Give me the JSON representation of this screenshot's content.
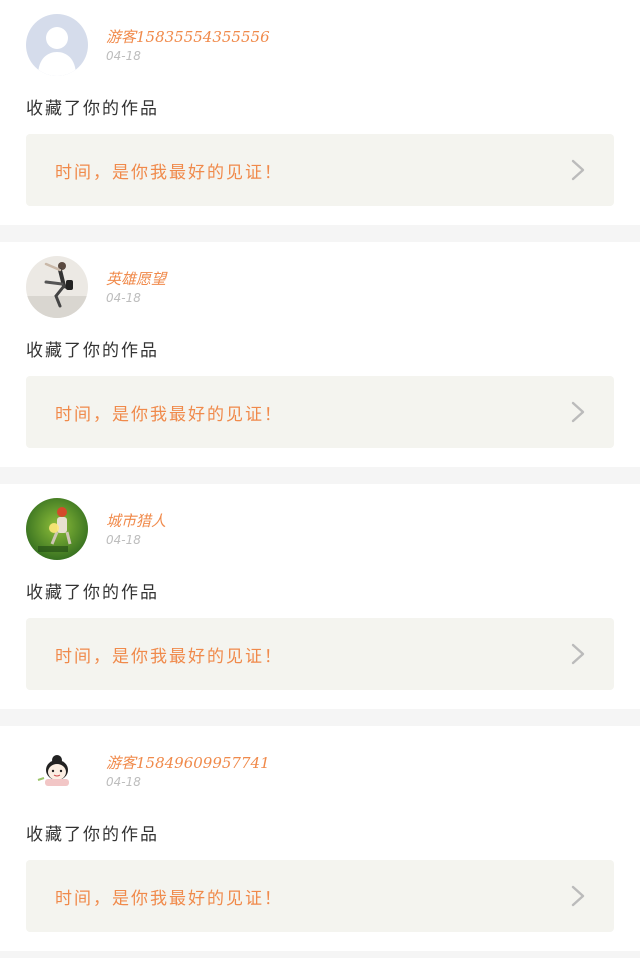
{
  "feed": [
    {
      "username": "游客15835554355556",
      "date": "04-18",
      "action": "收藏了你的作品",
      "quote": "时间，是你我最好的见证！",
      "avatar_icon": "default-user-avatar"
    },
    {
      "username": "英雄愿望",
      "date": "04-18",
      "action": "收藏了你的作品",
      "quote": "时间，是你我最好的见证！",
      "avatar_icon": "photo-avatar-dancer"
    },
    {
      "username": "城市猎人",
      "date": "04-18",
      "action": "收藏了你的作品",
      "quote": "时间，是你我最好的见证！",
      "avatar_icon": "photo-avatar-game-character"
    },
    {
      "username": "游客15849609957741",
      "date": "04-18",
      "action": "收藏了你的作品",
      "quote": "时间，是你我最好的见证！",
      "avatar_icon": "cartoon-avatar-girl"
    }
  ],
  "colors": {
    "accent": "#f08a4b",
    "quote_bg": "#f4f4ef",
    "divider": "#f5f5f5",
    "date": "#bdbdbd"
  }
}
